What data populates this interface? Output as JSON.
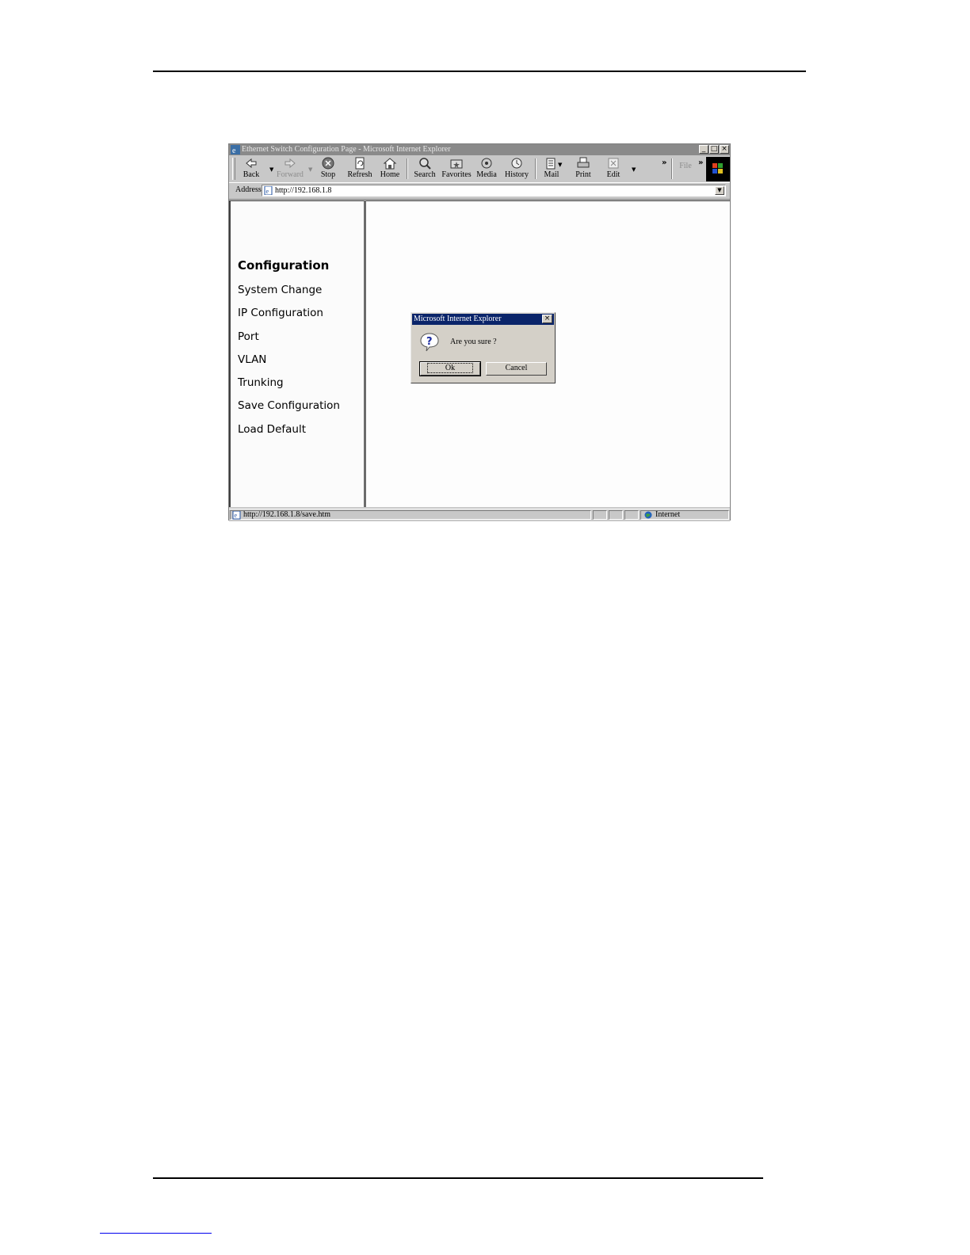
{
  "window": {
    "title": "Ethernet Switch Configuration Page - Microsoft Internet Explorer",
    "controls": [
      "_",
      "□",
      "×"
    ]
  },
  "toolbar": {
    "back": "Back",
    "forward": "Forward",
    "stop": "Stop",
    "refresh": "Refresh",
    "home": "Home",
    "search": "Search",
    "favorites": "Favorites",
    "media": "Media",
    "history": "History",
    "mail": "Mail",
    "print": "Print",
    "edit": "Edit",
    "file": "File",
    "chevron": "»"
  },
  "address": {
    "label": "Address",
    "value": "http://192.168.1.8"
  },
  "menu": {
    "heading": "Configuration",
    "items": [
      "System Change",
      "IP Configuration",
      "Port",
      "VLAN",
      "Trunking",
      "Save Configuration",
      "Load Default"
    ]
  },
  "dialog": {
    "title": "Microsoft Internet Explorer",
    "message": "Are you sure ?",
    "ok": "Ok",
    "cancel": "Cancel"
  },
  "status": {
    "url": "http://192.168.1.8/save.htm",
    "zone": "Internet"
  },
  "colors": {
    "dialog_titlebar": "#0a246a",
    "chrome": "#c8c8c8"
  }
}
